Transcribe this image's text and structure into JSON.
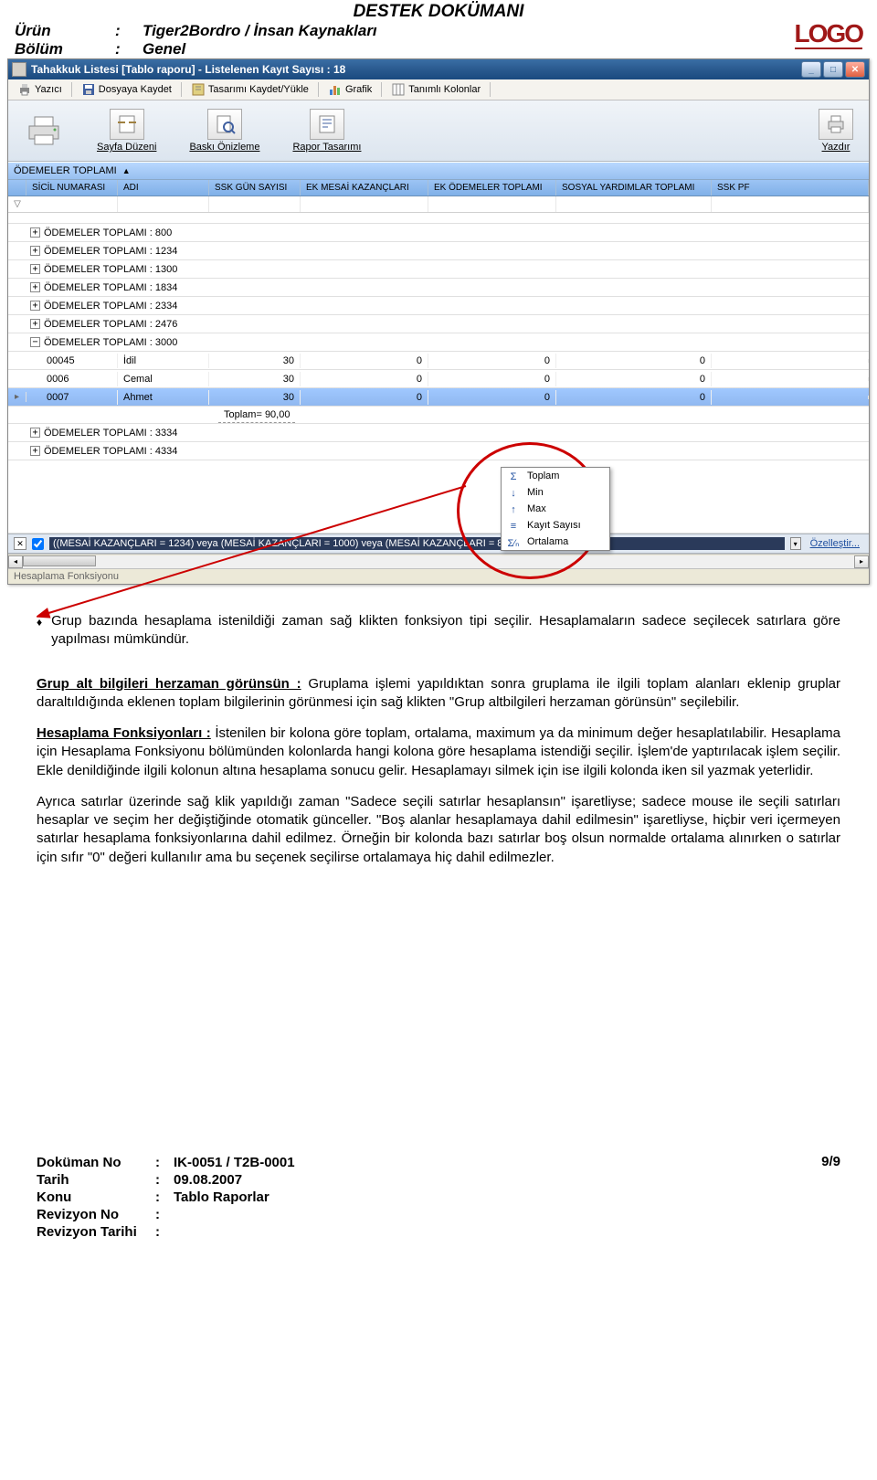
{
  "doc": {
    "title": "DESTEK DOKÜMANI",
    "product_label": "Ürün",
    "product_value": "Tiger2Bordro / İnsan Kaynakları",
    "section_label": "Bölüm",
    "section_value": "Genel",
    "logo": "LOGO"
  },
  "window": {
    "title": "Tahakkuk Listesi [Tablo raporu]  -  Listelenen Kayıt Sayısı : 18"
  },
  "toolbar1": {
    "print": "Yazıcı",
    "save_file": "Dosyaya Kaydet",
    "save_design": "Tasarımı Kaydet/Yükle",
    "chart": "Grafik",
    "columns": "Tanımlı Kolonlar"
  },
  "toolbar2": {
    "page_layout": "Sayfa Düzeni",
    "print_preview": "Baskı Önizleme",
    "report_design": "Rapor Tasarımı",
    "print_right": "Yazdır"
  },
  "group_header": "ÖDEMELER TOPLAMI",
  "columns": {
    "c0": "SİCİL NUMARASI",
    "c1": "ADI",
    "c2": "SSK GÜN SAYISI",
    "c3": "EK MESAİ KAZANÇLARI",
    "c4": "EK ÖDEMELER TOPLAMI",
    "c5": "SOSYAL YARDIMLAR TOPLAMI",
    "c6": "SSK PF"
  },
  "groups": {
    "g0": "ÖDEMELER TOPLAMI : 800",
    "g1": "ÖDEMELER TOPLAMI : 1234",
    "g2": "ÖDEMELER TOPLAMI : 1300",
    "g3": "ÖDEMELER TOPLAMI : 1834",
    "g4": "ÖDEMELER TOPLAMI : 2334",
    "g5": "ÖDEMELER TOPLAMI : 2476",
    "g6": "ÖDEMELER TOPLAMI : 3000",
    "g7": "ÖDEMELER TOPLAMI : 3334",
    "g8": "ÖDEMELER TOPLAMI : 4334"
  },
  "rows": [
    {
      "sicil": "00045",
      "adi": "İdil",
      "ssk": "30",
      "ek_mesai": "0",
      "ek_odeme": "0",
      "sosyal": "0"
    },
    {
      "sicil": "0006",
      "adi": "Cemal",
      "ssk": "30",
      "ek_mesai": "0",
      "ek_odeme": "0",
      "sosyal": "0"
    },
    {
      "sicil": "0007",
      "adi": "Ahmet",
      "ssk": "30",
      "ek_mesai": "0",
      "ek_odeme": "0",
      "sosyal": "0"
    }
  ],
  "sum_label": "Toplam= 90,00",
  "context_menu": {
    "m0": "Toplam",
    "m1": "Min",
    "m2": "Max",
    "m3": "Kayıt Sayısı",
    "m4": "Ortalama"
  },
  "filter_bar": {
    "text": "((MESAİ KAZANÇLARI = 1234) veya (MESAİ KAZANÇLARI = 1000) veya (MESAİ KAZANÇLARI = 800) veya (MESA",
    "customize": "Özelleştir..."
  },
  "bottom_tab": "Hesaplama Fonksiyonu",
  "body": {
    "bullet1": "Grup bazında hesaplama istenildiği zaman sağ klikten fonksiyon tipi seçilir. Hesaplamaların sadece seçilecek satırlara göre yapılması mümkündür.",
    "p2_label": "Grup alt bilgileri herzaman görünsün :",
    "p2_rest": " Gruplama işlemi yapıldıktan sonra gruplama ile ilgili toplam alanları eklenip gruplar daraltıldığında eklenen toplam bilgilerinin görünmesi için sağ klikten \"Grup altbilgileri herzaman görünsün\" seçilebilir.",
    "p3_label": "Hesaplama Fonksiyonları :",
    "p3_rest": " İstenilen bir kolona göre toplam, ortalama, maximum ya da minimum değer hesaplatılabilir. Hesaplama için Hesaplama Fonksiyonu bölümünden kolonlarda hangi kolona göre hesaplama istendiği seçilir. İşlem'de yaptırılacak işlem seçilir. Ekle denildiğinde ilgili kolonun altına hesaplama sonucu gelir. Hesaplamayı silmek için ise ilgili kolonda iken sil yazmak yeterlidir.",
    "p4": "Ayrıca satırlar üzerinde sağ klik yapıldığı zaman \"Sadece seçili satırlar hesaplansın\" işaretliyse; sadece mouse ile seçili satırları hesaplar ve seçim her değiştiğinde otomatik günceller. \"Boş alanlar hesaplamaya dahil edilmesin\" işaretliyse, hiçbir veri içermeyen satırlar hesaplama fonksiyonlarına dahil edilmez. Örneğin bir kolonda bazı satırlar boş olsun normalde ortalama alınırken o satırlar için sıfır \"0\" değeri kullanılır ama  bu seçenek seçilirse ortalamaya hiç dahil edilmezler."
  },
  "footer": {
    "doc_no_label": "Doküman No",
    "doc_no_value": "IK-0051  / T2B-0001",
    "date_label": "Tarih",
    "date_value": "09.08.2007",
    "subject_label": "Konu",
    "subject_value": "Tablo Raporlar",
    "rev_no_label": "Revizyon No",
    "rev_date_label": "Revizyon Tarihi",
    "page": "9/9"
  }
}
